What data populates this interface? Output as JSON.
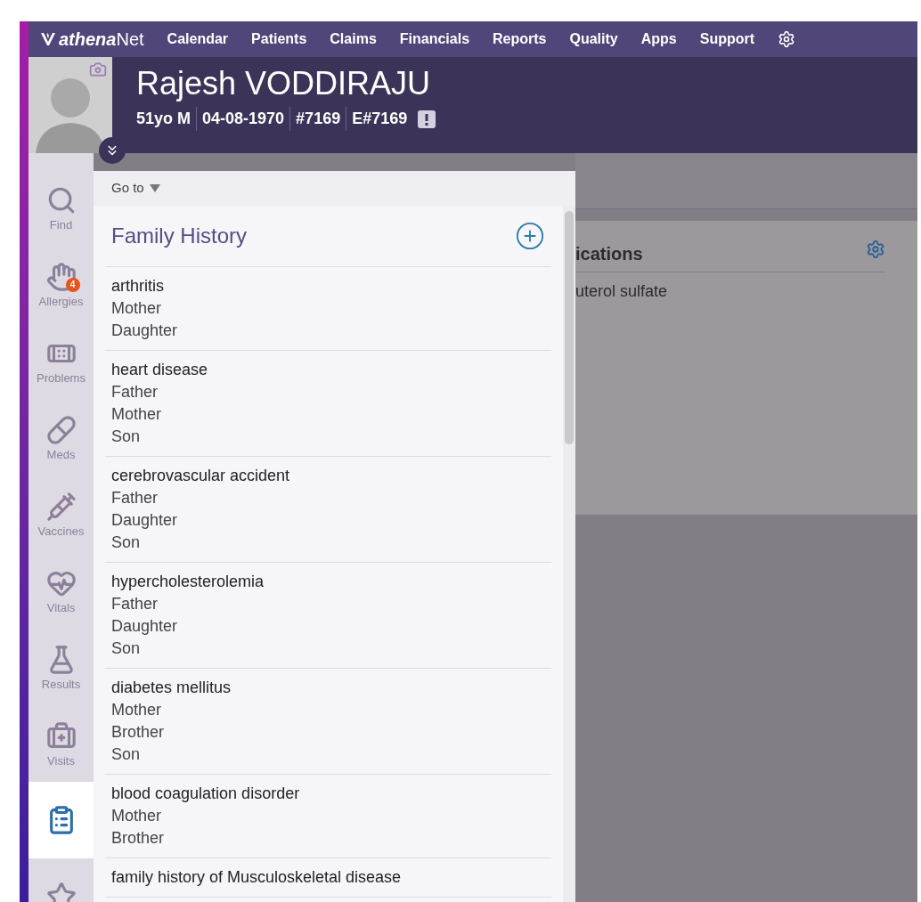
{
  "nav": {
    "logo": {
      "bold": "athena",
      "light": "Net"
    },
    "items": [
      "Calendar",
      "Patients",
      "Claims",
      "Financials",
      "Reports",
      "Quality",
      "Apps",
      "Support"
    ]
  },
  "patient": {
    "name": "Rajesh VODDIRAJU",
    "details": [
      "51yo M",
      "04-08-1970",
      "#7169",
      "E#7169"
    ]
  },
  "sidebar": {
    "items": [
      {
        "kind": "find",
        "label": "Find",
        "selected": false
      },
      {
        "kind": "allergies",
        "label": "Allergies",
        "badge": "4",
        "selected": false
      },
      {
        "kind": "problems",
        "label": "Problems",
        "selected": false
      },
      {
        "kind": "meds",
        "label": "Meds",
        "selected": false
      },
      {
        "kind": "vaccines",
        "label": "Vaccines",
        "selected": false
      },
      {
        "kind": "vitals",
        "label": "Vitals",
        "selected": false
      },
      {
        "kind": "results",
        "label": "Results",
        "selected": false
      },
      {
        "kind": "visits",
        "label": "Visits",
        "selected": false
      },
      {
        "kind": "clipboard",
        "selected": true
      },
      {
        "kind": "star",
        "selected": false
      }
    ]
  },
  "panel": {
    "goto": "Go to",
    "title": "Family History",
    "entries": [
      {
        "condition": "arthritis",
        "relatives": [
          "Mother",
          "Daughter"
        ]
      },
      {
        "condition": "heart disease",
        "relatives": [
          "Father",
          "Mother",
          "Son"
        ]
      },
      {
        "condition": "cerebrovascular accident",
        "relatives": [
          "Father",
          "Daughter",
          "Son"
        ]
      },
      {
        "condition": "hypercholesterolemia",
        "relatives": [
          "Father",
          "Daughter",
          "Son"
        ]
      },
      {
        "condition": "diabetes mellitus",
        "relatives": [
          "Mother",
          "Brother",
          "Son"
        ]
      },
      {
        "condition": "blood coagulation disorder",
        "relatives": [
          "Mother",
          "Brother"
        ]
      },
      {
        "condition": "family history of Musculoskeletal disease"
      }
    ]
  },
  "background_card": {
    "title": "ications",
    "item": "uterol sulfate"
  }
}
